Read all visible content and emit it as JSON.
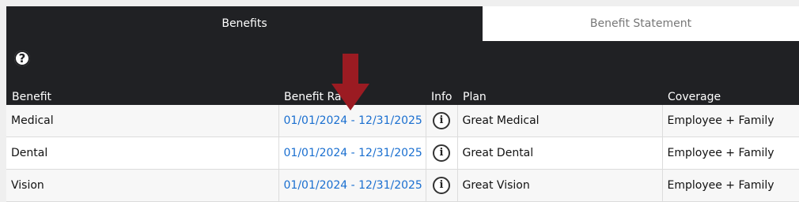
{
  "tabs": {
    "active": "Benefits",
    "inactive": "Benefit Statement"
  },
  "help_icon": "question-circle-icon",
  "columns": {
    "benefit": "Benefit",
    "range": "Benefit Ra",
    "info": "Info",
    "plan": "Plan",
    "coverage": "Coverage"
  },
  "rows": [
    {
      "benefit": "Medical",
      "range": "01/01/2024 - 12/31/2025",
      "info_icon": "info-icon",
      "plan": "Great Medical",
      "coverage": "Employee + Family"
    },
    {
      "benefit": "Dental",
      "range": "01/01/2024 - 12/31/2025",
      "info_icon": "info-icon",
      "plan": "Great Dental",
      "coverage": "Employee + Family"
    },
    {
      "benefit": "Vision",
      "range": "01/01/2024 - 12/31/2025",
      "info_icon": "info-icon",
      "plan": "Great Vision",
      "coverage": "Employee + Family"
    }
  ],
  "colors": {
    "header_bg": "#202124",
    "link": "#1a6fd0",
    "annotation_arrow": "#9b1b22"
  }
}
